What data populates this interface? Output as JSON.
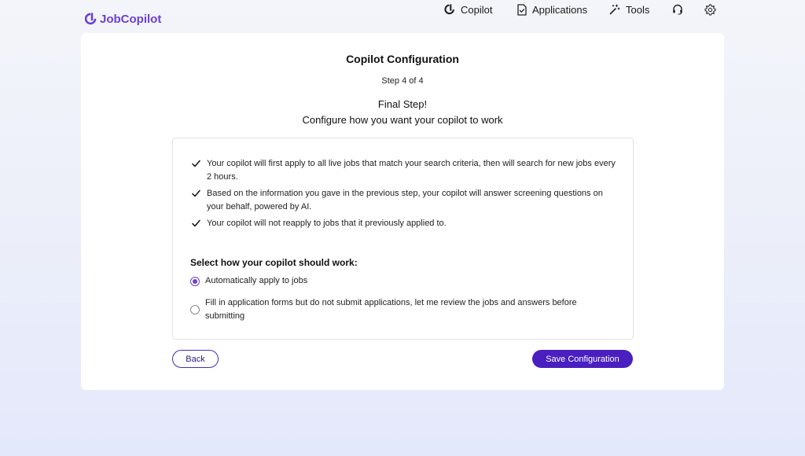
{
  "app": {
    "logo_text": "JobCopilot",
    "brand_color": "#6c3fd6",
    "primary_button_color": "#4a1fc0"
  },
  "nav": {
    "items": [
      {
        "label": "Copilot",
        "icon": "copilot-logo-icon"
      },
      {
        "label": "Applications",
        "icon": "document-icon"
      },
      {
        "label": "Tools",
        "icon": "magic-wand-icon"
      }
    ],
    "support_icon": "headset-icon",
    "settings_icon": "gear-icon"
  },
  "card": {
    "title": "Copilot Configuration",
    "step": "Step 4 of 4",
    "heading": "Final Step!",
    "subheading": "Configure how you want your copilot to work"
  },
  "info": {
    "items": [
      "Your copilot will first apply to all live jobs that match your search criteria, then will search for new jobs every 2 hours.",
      "Based on the information you gave in the previous step, your copilot will answer screening questions on your behalf, powered by AI.",
      "Your copilot will not reapply to jobs that it previously applied to."
    ]
  },
  "mode": {
    "title": "Select how your copilot should work:",
    "options": [
      {
        "label": "Automatically apply to jobs",
        "selected": true
      },
      {
        "label": "Fill in application forms but do not submit applications, let me review the jobs and answers before submitting",
        "selected": false
      }
    ]
  },
  "actions": {
    "back_label": "Back",
    "save_label": "Save Configuration"
  }
}
